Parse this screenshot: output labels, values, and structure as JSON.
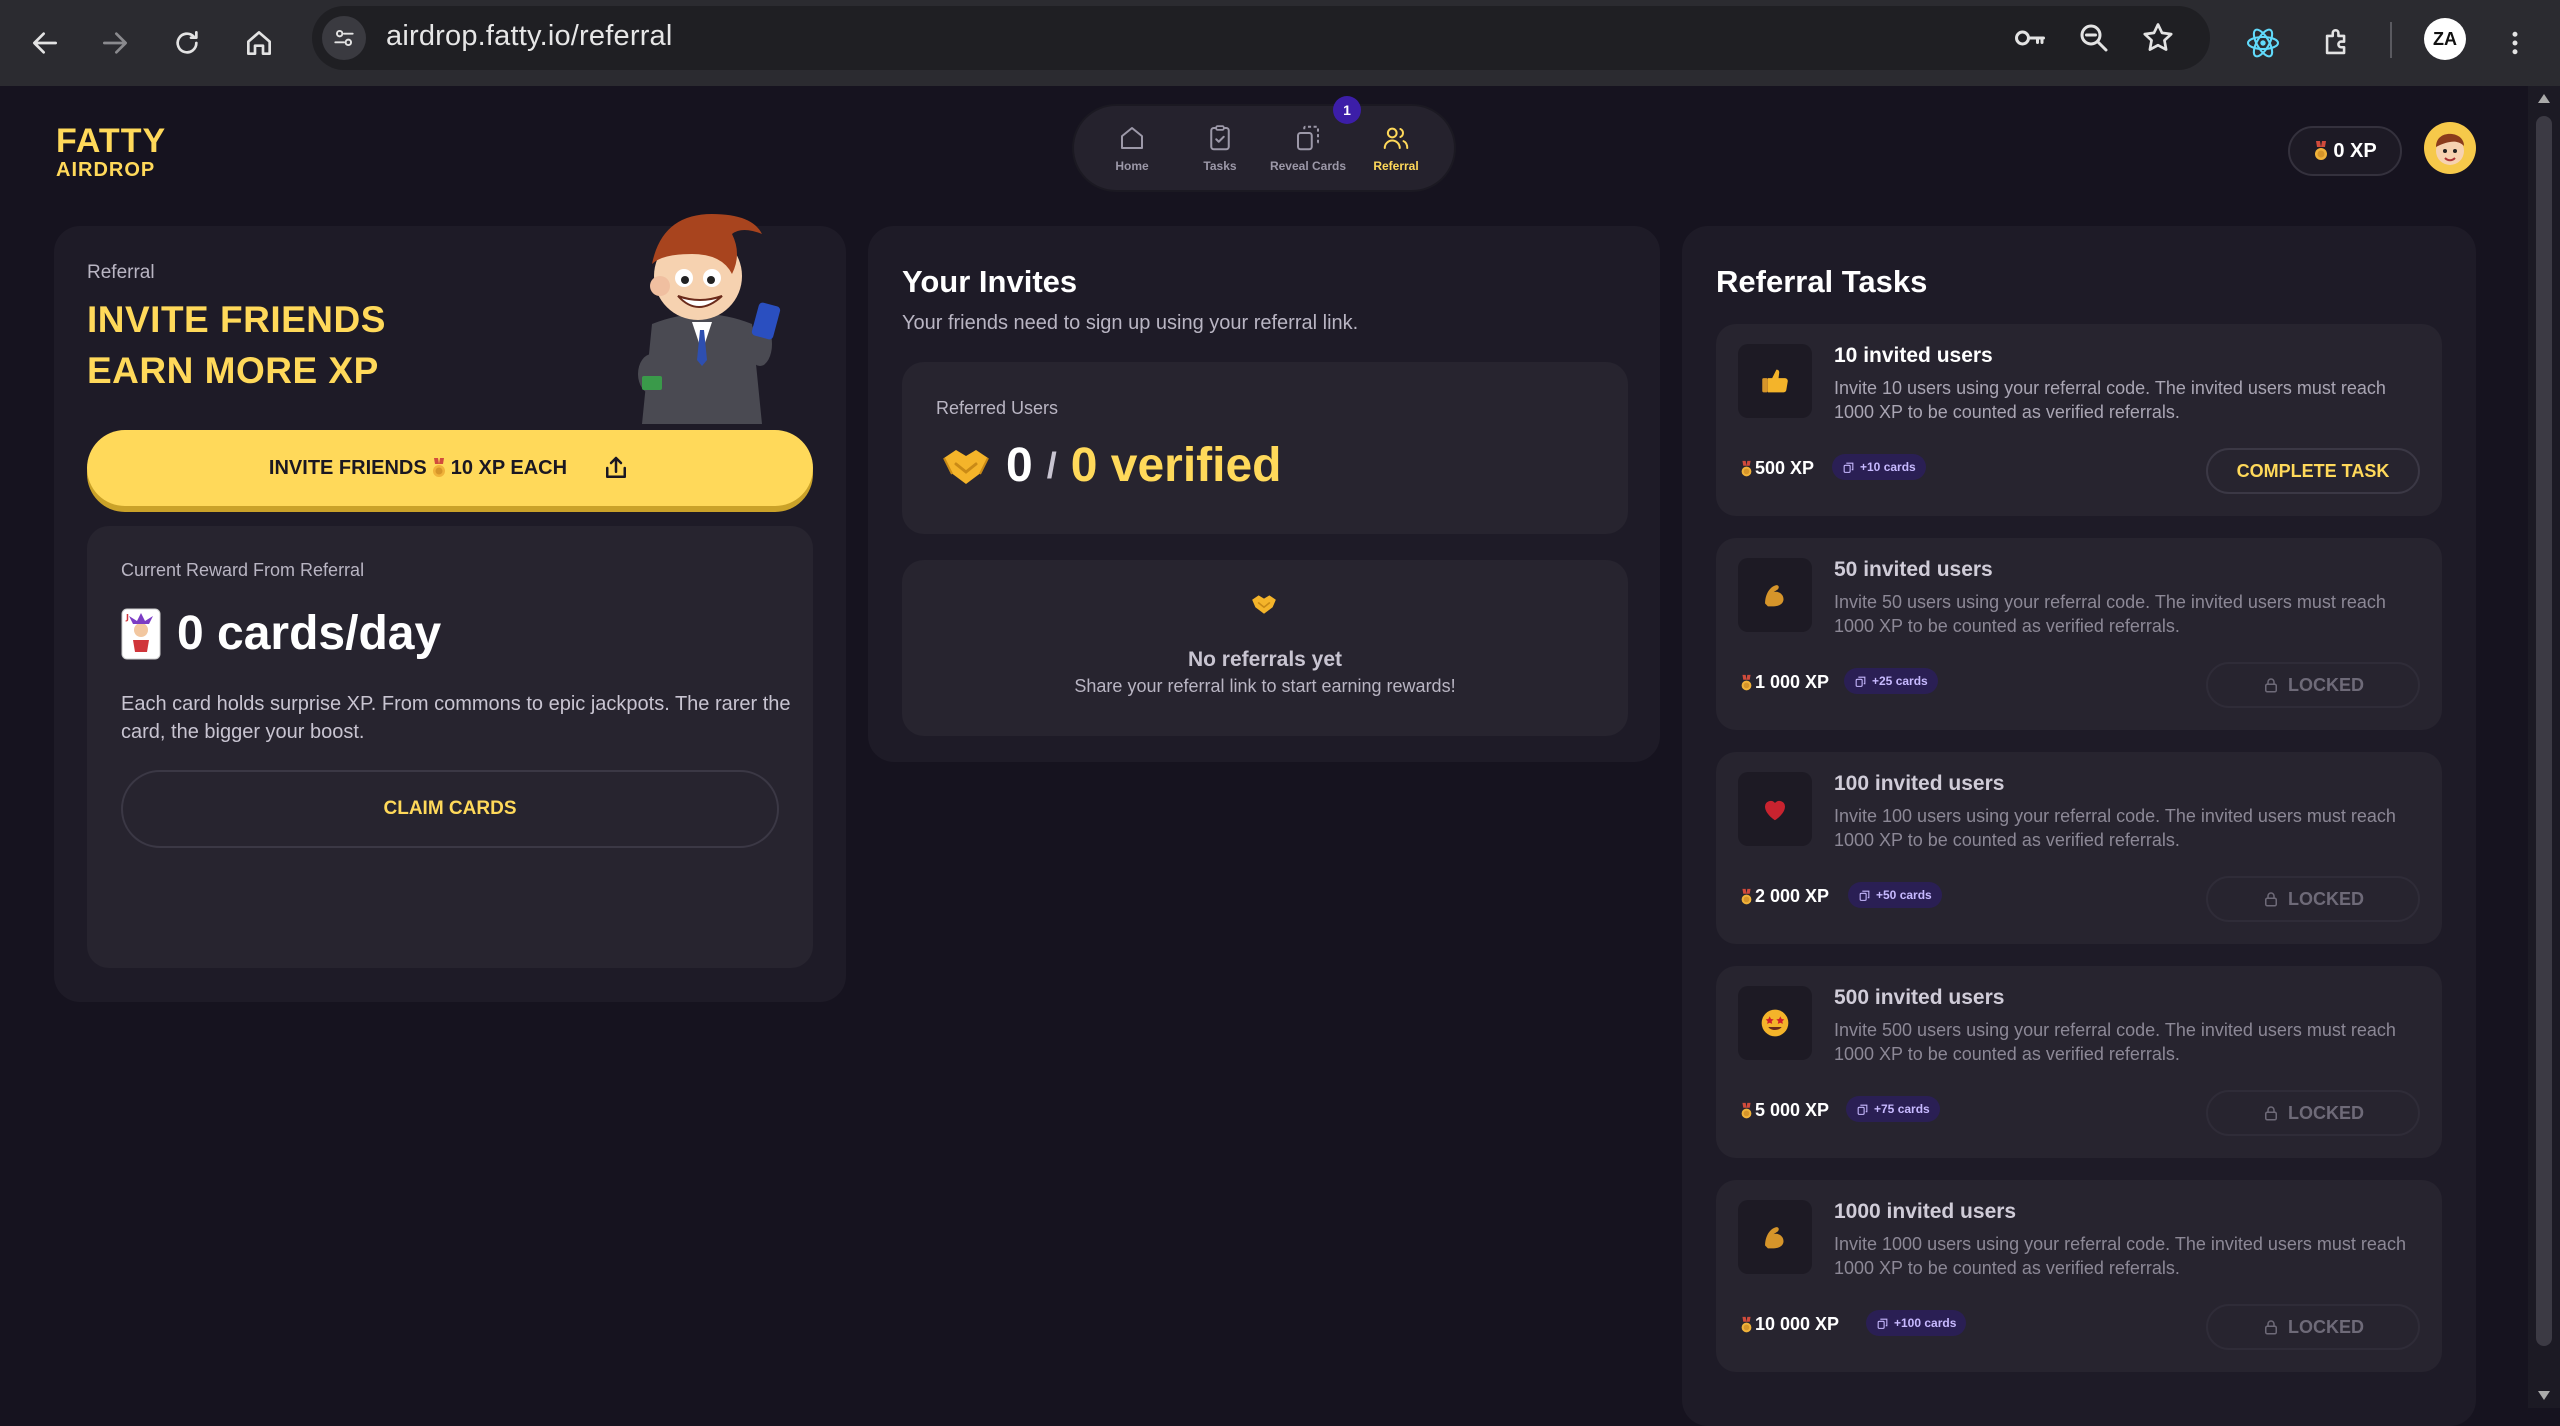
{
  "browser": {
    "url": "airdrop.fatty.io/referral",
    "extension_badge": "",
    "profile_initials": "ZA"
  },
  "logo": {
    "line1": "FATTY",
    "line2": "AIRDROP"
  },
  "nav": {
    "items": [
      {
        "label": "Home",
        "icon": "home-icon"
      },
      {
        "label": "Tasks",
        "icon": "clipboard-check-icon"
      },
      {
        "label": "Reveal Cards",
        "icon": "cards-icon"
      },
      {
        "label": "Referral",
        "icon": "users-icon"
      }
    ],
    "active": "Referral",
    "reveal_badge": "1"
  },
  "header": {
    "xp": "0 XP"
  },
  "referral": {
    "label": "Referral",
    "title_line1": "INVITE FRIENDS",
    "title_line2": "EARN MORE XP",
    "invite_btn_prefix": "INVITE FRIENDS",
    "invite_btn_suffix": "10 XP EACH",
    "reward_label": "Current Reward From Referral",
    "reward_value": "0 cards/day",
    "reward_desc": "Each card holds surprise XP. From commons to epic jackpots. The rarer the card, the bigger your boost.",
    "claim_btn": "CLAIM CARDS"
  },
  "invites": {
    "title": "Your Invites",
    "subtitle": "Your friends need to sign up using your referral link.",
    "referred_label": "Referred Users",
    "referred_count": "0",
    "slash": "/",
    "verified": "0 verified",
    "empty_title": "No referrals yet",
    "empty_sub": "Share your referral link to start earning rewards!"
  },
  "tasks": {
    "title": "Referral Tasks",
    "items": [
      {
        "title": "10 invited users",
        "desc": "Invite 10 users using your referral code. The invited users must reach 1000 XP to be counted as verified referrals.",
        "xp": "500 XP",
        "cards": "+10 cards",
        "button": "COMPLETE TASK",
        "icon": "thumbs-up-icon",
        "locked": false
      },
      {
        "title": "50 invited users",
        "desc": "Invite 50 users using your referral code. The invited users must reach 1000 XP to be counted as verified referrals.",
        "xp": "1 000 XP",
        "cards": "+25 cards",
        "button": "LOCKED",
        "icon": "flexed-biceps-icon",
        "locked": true
      },
      {
        "title": "100 invited users",
        "desc": "Invite 100 users using your referral code. The invited users must reach 1000 XP to be counted as verified referrals.",
        "xp": "2 000 XP",
        "cards": "+50 cards",
        "button": "LOCKED",
        "icon": "heart-icon",
        "locked": true
      },
      {
        "title": "500 invited users",
        "desc": "Invite 500 users using your referral code. The invited users must reach 1000 XP to be counted as verified referrals.",
        "xp": "5 000 XP",
        "cards": "+75 cards",
        "button": "LOCKED",
        "icon": "star-eyes-icon",
        "locked": true
      },
      {
        "title": "1000 invited users",
        "desc": "Invite 1000 users using your referral code. The invited users must reach 1000 XP to be counted as verified referrals.",
        "xp": "10 000 XP",
        "cards": "+100 cards",
        "button": "LOCKED",
        "icon": "flexed-biceps-icon",
        "locked": true
      }
    ]
  },
  "colors": {
    "accent": "#ffd95a",
    "bg": "#16131f",
    "panel": "#1e1b27",
    "card": "#27242f",
    "badge": "#3c1ea8"
  }
}
